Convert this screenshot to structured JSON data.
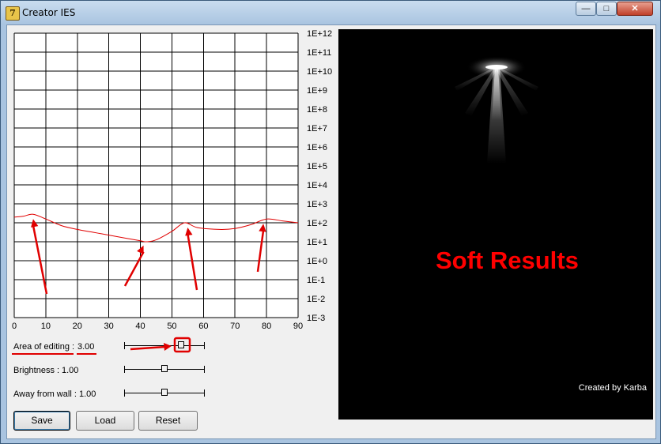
{
  "window": {
    "title": "Creator IES"
  },
  "chart_data": {
    "type": "line",
    "x": [
      0,
      3,
      6,
      10,
      15,
      20,
      25,
      30,
      35,
      40,
      42,
      45,
      50,
      54,
      58,
      65,
      70,
      75,
      80,
      85,
      90
    ],
    "y_exponent": [
      2.3,
      2.35,
      2.45,
      2.2,
      1.85,
      1.65,
      1.5,
      1.35,
      1.2,
      1.05,
      1.0,
      1.1,
      1.55,
      2.0,
      1.75,
      1.65,
      1.7,
      1.9,
      2.2,
      2.1,
      2.0
    ],
    "xlabel": "",
    "ylabel": "",
    "xlim": [
      0,
      90
    ],
    "x_ticks": [
      "0",
      "10",
      "20",
      "30",
      "40",
      "50",
      "60",
      "70",
      "80",
      "90"
    ],
    "y_ticks": [
      "1E+12",
      "1E+11",
      "1E+10",
      "1E+9",
      "1E+8",
      "1E+7",
      "1E+6",
      "1E+5",
      "1E+4",
      "1E+3",
      "1E+2",
      "1E+1",
      "1E+0",
      "1E-1",
      "1E-2",
      "1E-3"
    ],
    "y_scale": "log",
    "grid": true,
    "line_color": "#e00000",
    "arrows_at_x": [
      6,
      41,
      55,
      79
    ]
  },
  "controls": {
    "area_label": "Area of editing :",
    "area_value": "3.00",
    "area_level": 0.72,
    "brightness_label": "Brightness :",
    "brightness_value": "1.00",
    "brightness_level": 0.5,
    "wall_label": "Away from wall :",
    "wall_value": "1.00",
    "wall_level": 0.5
  },
  "buttons": {
    "save": "Save",
    "load": "Load",
    "reset": "Reset"
  },
  "preview": {
    "annotation": "Soft Results",
    "credit": "Created by Karba"
  },
  "colors": {
    "accent_red": "#e00000",
    "preview_bg": "#000000",
    "annotation": "#ff0000"
  },
  "icons": {
    "app": "ies-app-icon",
    "minimize": "minimize-icon",
    "maximize": "maximize-icon",
    "close": "close-icon"
  }
}
